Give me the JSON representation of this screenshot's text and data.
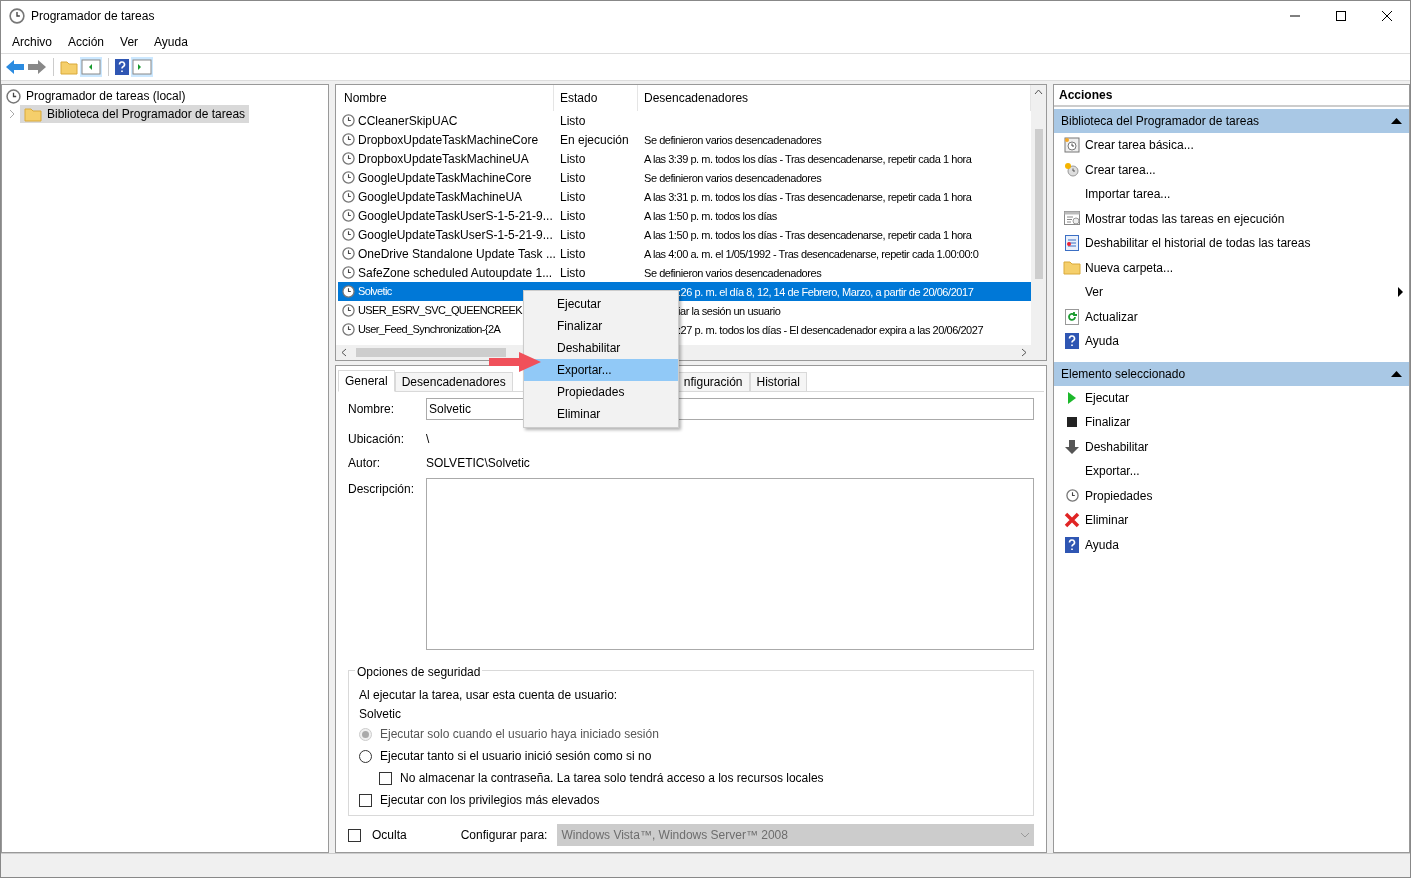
{
  "window": {
    "title": "Programador de tareas"
  },
  "menu": [
    "Archivo",
    "Acción",
    "Ver",
    "Ayuda"
  ],
  "tree": [
    {
      "label": "Programador de tareas (local)",
      "selected": false,
      "children": [
        {
          "label": "Biblioteca del Programador de tareas",
          "selected": true
        }
      ]
    }
  ],
  "task_list": {
    "columns": [
      "Nombre",
      "Estado",
      "Desencadenadores"
    ],
    "rows": [
      {
        "name": "CCleanerSkipUAC",
        "status": "Listo",
        "selected": false
      },
      {
        "name": "DropboxUpdateTaskMachineCore",
        "status": "En ejecución",
        "trigger": "Se definieron varios desencadenadores",
        "selected": false
      },
      {
        "name": "DropboxUpdateTaskMachineUA",
        "status": "Listo",
        "trigger": "A las 3:39 p. m. todos los días - Tras desencadenarse, repetir cada 1 hora",
        "selected": false
      },
      {
        "name": "GoogleUpdateTaskMachineCore",
        "status": "Listo",
        "trigger": "Se definieron varios desencadenadores",
        "selected": false
      },
      {
        "name": "GoogleUpdateTaskMachineUA",
        "status": "Listo",
        "trigger": "A las 3:31 p. m. todos los días - Tras desencadenarse, repetir cada 1 hora",
        "selected": false
      },
      {
        "name": "GoogleUpdateTaskUserS-1-5-21-9...",
        "status": "Listo",
        "trigger": "A las 1:50 p. m. todos los días",
        "selected": false
      },
      {
        "name": "GoogleUpdateTaskUserS-1-5-21-9...",
        "status": "Listo",
        "trigger": "A las 1:50 p. m. todos los días - Tras desencadenarse, repetir cada 1 hora",
        "selected": false
      },
      {
        "name": "OneDrive Standalone Update Task ...",
        "status": "Listo",
        "trigger": "A las 4:00 a. m. el 1/05/1992 - Tras desencadenarse, repetir cada 1.00:00:0",
        "selected": false
      },
      {
        "name": "SafeZone scheduled Autoupdate 1...",
        "status": "Listo",
        "trigger": "Se definieron varios desencadenadores",
        "selected": false
      },
      {
        "name": "Solvetic",
        "trigger": ":26 p. m. el día 8, 12, 14 de Febrero, Marzo, a partir de 20/06/2017",
        "selected": true
      },
      {
        "name": "USER_ESRV_SVC_QUEENCREEK",
        "trigger": "iar la sesión un usuario",
        "selected": false
      },
      {
        "name": "User_Feed_Synchronization-{2A",
        "trigger": ":27 p. m. todos los días - El desencadenador expira a las 20/06/2027",
        "selected": false
      }
    ]
  },
  "context_menu": [
    {
      "label": "Ejecutar",
      "selected": false
    },
    {
      "label": "Finalizar",
      "selected": false
    },
    {
      "label": "Deshabilitar",
      "selected": false
    },
    {
      "label": "Exportar...",
      "selected": true
    },
    {
      "label": "Propiedades",
      "selected": false
    },
    {
      "label": "Eliminar",
      "selected": false
    }
  ],
  "detail_tabs": [
    {
      "label": "General",
      "selected": true
    },
    {
      "label": "Desencadenadores",
      "selected": false
    },
    {
      "label": "nfiguración",
      "selected": false
    },
    {
      "label": "Historial",
      "selected": false
    }
  ],
  "general": {
    "name_label": "Nombre:",
    "name_value": "Solvetic",
    "location_label": "Ubicación:",
    "location_value": "\\",
    "author_label": "Autor:",
    "author_value": "SOLVETIC\\Solvetic",
    "description_label": "Descripción:"
  },
  "security": {
    "title": "Opciones de seguridad",
    "account_prompt": "Al ejecutar la tarea, usar esta cuenta de usuario:",
    "account": "Solvetic",
    "options": [
      {
        "kind": "radio",
        "label": "Ejecutar solo cuando el usuario haya iniciado sesión",
        "checked": true,
        "disabled": true
      },
      {
        "kind": "radio",
        "label": "Ejecutar tanto si el usuario inició sesión como si no",
        "checked": false,
        "disabled": false,
        "children": [
          {
            "kind": "checkbox",
            "label": "No almacenar la contraseña. La tarea solo tendrá acceso a los recursos locales",
            "checked": false,
            "disabled": false
          }
        ]
      },
      {
        "kind": "checkbox",
        "label": "Ejecutar con los privilegios más elevados",
        "checked": false,
        "disabled": false
      }
    ]
  },
  "hidden": {
    "label": "Oculta",
    "checked": false
  },
  "configure": {
    "label": "Configurar para:",
    "value": "Windows Vista™, Windows Server™ 2008",
    "disabled": true
  },
  "actions": {
    "title": "Acciones",
    "sections": [
      {
        "title": "Biblioteca del Programador de tareas",
        "expanded": true,
        "items": [
          {
            "label": "Crear tarea básica...",
            "submenu": false
          },
          {
            "label": "Crear tarea...",
            "submenu": false
          },
          {
            "label": "Importar tarea...",
            "submenu": false
          },
          {
            "label": "Mostrar todas las tareas en ejecución",
            "submenu": false
          },
          {
            "label": "Deshabilitar el historial de todas las tareas",
            "submenu": false
          },
          {
            "label": "Nueva carpeta...",
            "submenu": false
          },
          {
            "label": "Ver",
            "submenu": true
          },
          {
            "label": "Actualizar",
            "submenu": false
          },
          {
            "label": "Ayuda",
            "submenu": false
          }
        ]
      },
      {
        "title": "Elemento seleccionado",
        "expanded": true,
        "items": [
          {
            "label": "Ejecutar",
            "submenu": false
          },
          {
            "label": "Finalizar",
            "submenu": false
          },
          {
            "label": "Deshabilitar",
            "submenu": false
          },
          {
            "label": "Exportar...",
            "submenu": false
          },
          {
            "label": "Propiedades",
            "submenu": false
          },
          {
            "label": "Eliminar",
            "submenu": false
          },
          {
            "label": "Ayuda",
            "submenu": false
          }
        ]
      }
    ]
  }
}
